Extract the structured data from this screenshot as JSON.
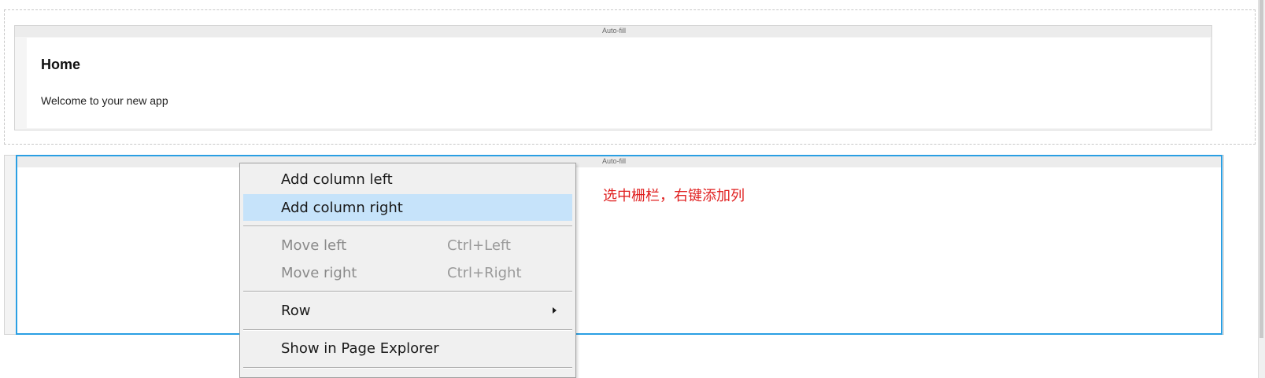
{
  "row1": {
    "autofill_label": "Auto-fill",
    "title": "Home",
    "text": "Welcome to your new app"
  },
  "row2": {
    "autofill_label": "Auto-fill"
  },
  "annotation": "选中栅栏，右键添加列",
  "context_menu": {
    "items": [
      {
        "label": "Add column left",
        "shortcut": "",
        "state": "enabled"
      },
      {
        "label": "Add column right",
        "shortcut": "",
        "state": "hovered"
      },
      {
        "label": "Move left",
        "shortcut": "Ctrl+Left",
        "state": "disabled"
      },
      {
        "label": "Move right",
        "shortcut": "Ctrl+Right",
        "state": "disabled"
      },
      {
        "label": "Row",
        "shortcut": "",
        "state": "submenu"
      },
      {
        "label": "Show in Page Explorer",
        "shortcut": "",
        "state": "enabled"
      }
    ]
  },
  "colors": {
    "selection": "#2a9fe3",
    "menu_hover": "#c6e3fa",
    "annotation": "#e02020"
  }
}
